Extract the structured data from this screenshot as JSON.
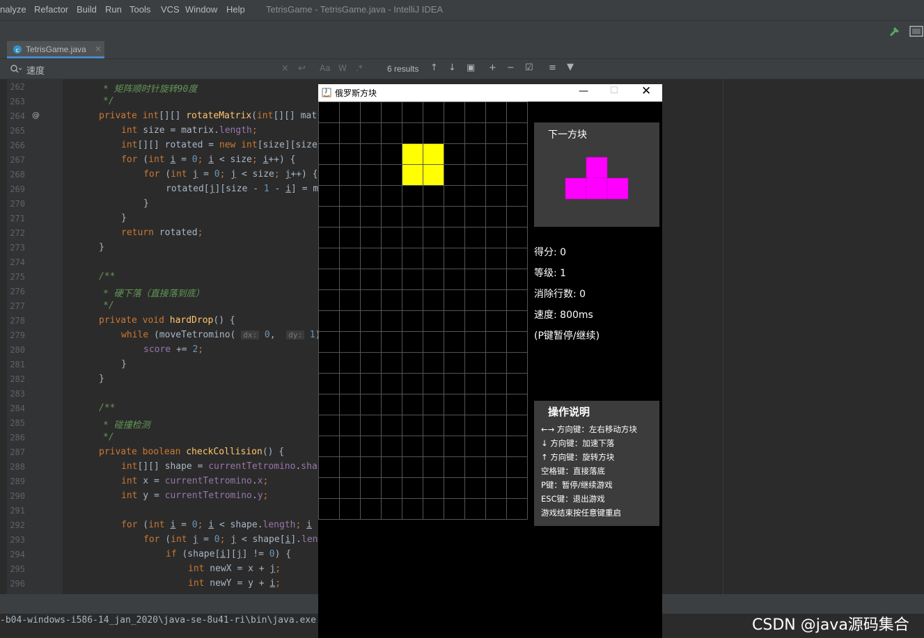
{
  "menu": {
    "items": [
      "nalyze",
      "Refactor",
      "Build",
      "Run",
      "Tools",
      "VCS",
      "Window",
      "Help"
    ],
    "window_title": "TetrisGame - TetrisGame.java - IntelliJ IDEA"
  },
  "tab": {
    "label": "TetrisGame.java"
  },
  "search": {
    "query": "速度",
    "results": "6 results",
    "match_case": "Aa",
    "words": "W",
    "regex": ".*"
  },
  "editor": {
    "line_numbers": [
      "262",
      "263",
      "264",
      "265",
      "266",
      "267",
      "268",
      "269",
      "270",
      "271",
      "272",
      "273",
      "274",
      "275",
      "276",
      "277",
      "278",
      "279",
      "280",
      "281",
      "282",
      "283",
      "284",
      "285",
      "286",
      "287",
      "288",
      "289",
      "290",
      "291",
      "292",
      "293",
      "294",
      "295",
      "296"
    ]
  },
  "console": {
    "path_text": "-b04-windows-i586-14_jan_2020\\java-se-8u41-ri\\bin\\java.exe"
  },
  "watermark": "CSDN @java源码集合",
  "game": {
    "title": "俄罗斯方块",
    "board_cols": 10,
    "board_rows": 20,
    "current_color": "#ffff00",
    "next_color": "#ff00ff",
    "next_label": "下一方块",
    "score_text": "得分: 0",
    "level_text": "等级: 1",
    "lines_text": "消除行数: 0",
    "speed_text": "速度: 800ms",
    "pause_hint": "(P键暂停/继续)",
    "help_title": "操作说明",
    "help_lines": [
      "←→ 方向键：左右移动方块",
      "↓ 方向键：加速下落",
      "↑ 方向键：旋转方块",
      "空格键：直接落底",
      "P键：暂停/继续游戏",
      "ESC键：退出游戏",
      "游戏结束按任意键重启"
    ]
  },
  "colors": {
    "ide_bg": "#2b2b2b",
    "keyword": "#cc7832",
    "comment": "#629755",
    "method": "#ffc66d",
    "field": "#9876aa"
  }
}
